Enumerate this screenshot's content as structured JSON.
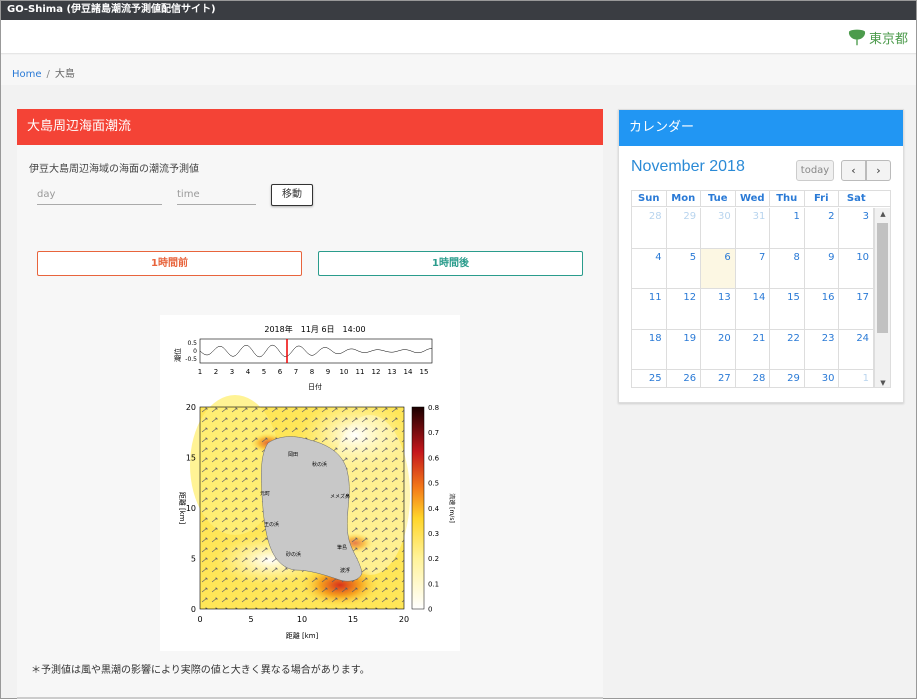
{
  "app": {
    "title": "GO-Shima (伊豆諸島潮流予測値配信サイト)",
    "logo_text": "東京都"
  },
  "breadcrumb": {
    "home": "Home",
    "separator": "/",
    "current": "大島"
  },
  "main_panel": {
    "title": "大島周辺海面潮流",
    "description": "伊豆大島周辺海域の海面の潮流予測値",
    "day_placeholder": "day",
    "time_placeholder": "time",
    "move_label": "移動",
    "prev_label": "1時間前",
    "next_label": "1時間後",
    "note": "＊予測値は風や黒潮の影響により実際の値と大きく異なる場合があります。"
  },
  "plot": {
    "timestamp": "2018年　11月 6日　14:00",
    "tide_ylabel": "潮位",
    "tide_ticks": [
      "0.5",
      "0",
      "-0.5"
    ],
    "day_ticks": [
      "1",
      "2",
      "3",
      "4",
      "5",
      "6",
      "7",
      "8",
      "9",
      "10",
      "11",
      "12",
      "13",
      "14",
      "15"
    ],
    "day_xlabel": "日付",
    "map_xticks": [
      "0",
      "5",
      "10",
      "15",
      "20"
    ],
    "map_yticks": [
      "20",
      "15",
      "10",
      "5",
      "0"
    ],
    "map_xlabel": "距離 [km]",
    "map_ylabel": "距離 [km]",
    "cbar_ticks": [
      "0.8",
      "0.7",
      "0.6",
      "0.5",
      "0.4",
      "0.3",
      "0.2",
      "0.1",
      "0"
    ],
    "cbar_label": "流速 [m/s]",
    "place_names": [
      "岡田",
      "秋の浜",
      "元町",
      "メメズ鼻",
      "王の浜",
      "筆島",
      "波浮",
      "砂の浜"
    ],
    "colors": {
      "land": "#c8c8c8",
      "low_speed": "#ffffff",
      "mid_speed": "#ffe34a",
      "high_speed": "#c4161c"
    }
  },
  "calendar": {
    "title": "カレンダー",
    "month_label": "November 2018",
    "today_label": "today",
    "prev_icon": "‹",
    "next_icon": "›",
    "dow": [
      "Sun",
      "Mon",
      "Tue",
      "Wed",
      "Thu",
      "Fri",
      "Sat"
    ],
    "today_date": "6",
    "weeks": [
      [
        "28",
        "29",
        "30",
        "31",
        "1",
        "2",
        "3"
      ],
      [
        "4",
        "5",
        "6",
        "7",
        "8",
        "9",
        "10"
      ],
      [
        "11",
        "12",
        "13",
        "14",
        "15",
        "16",
        "17"
      ],
      [
        "18",
        "19",
        "20",
        "21",
        "22",
        "23",
        "24"
      ],
      [
        "25",
        "26",
        "27",
        "28",
        "29",
        "30",
        "1"
      ]
    ]
  }
}
